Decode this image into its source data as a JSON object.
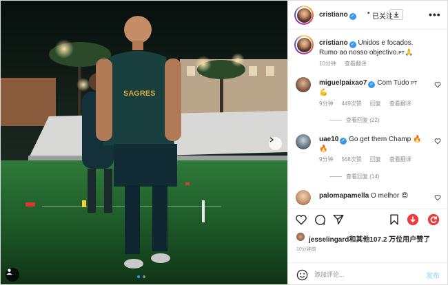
{
  "header": {
    "username": "cristiano",
    "follow_state": "已关注",
    "more_label": "•••"
  },
  "caption": {
    "username": "cristiano",
    "text_line1": "Unidos e focados.",
    "text_line2": "Rumo ao nosso objectivo.",
    "text_suffix": "PT",
    "emoji": "🙏",
    "time": "10分钟",
    "translate": "查看翻译"
  },
  "comments": [
    {
      "username": "miguelpaixao7",
      "text": "Com Tudo",
      "suffix": "PT",
      "emoji": "💪",
      "time": "9分钟",
      "likes": "449次赞",
      "reply": "回复",
      "translate": "查看翻译",
      "view_replies": "查看回复 (22)"
    },
    {
      "username": "uae10",
      "text": "Go get them Champ",
      "emoji": "🔥",
      "emoji2": "🔥",
      "time": "9分钟",
      "likes": "568次赞",
      "reply": "回复",
      "translate": "查看翻译",
      "view_replies": "查看回复 (14)"
    },
    {
      "username": "palomapamella",
      "text": "O melhor",
      "emoji": "😍"
    }
  ],
  "likes": {
    "username": "jesselingard",
    "text": "和其他107.2 万位用户赞了"
  },
  "time_ago": "10分钟前",
  "add_comment": {
    "placeholder": "添加评论...",
    "post_label": "发布"
  },
  "colors": {
    "verified": "#3897f0",
    "post_disabled": "#b2dffc",
    "dot_active": "#3897f0"
  }
}
